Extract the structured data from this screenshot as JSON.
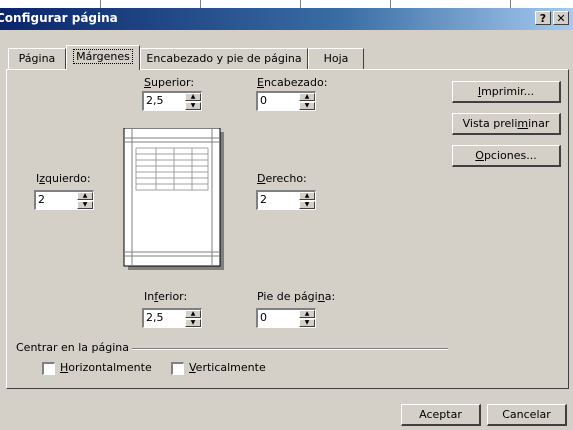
{
  "window": {
    "title": "Configurar página",
    "help_glyph": "?",
    "close_glyph": "✕"
  },
  "tabs": [
    {
      "label": "Página",
      "active": false
    },
    {
      "label": "Márgenes",
      "active": true
    },
    {
      "label": "Encabezado y pie de página",
      "active": false
    },
    {
      "label": "Hoja",
      "active": false
    }
  ],
  "margins": {
    "superior": {
      "label_pre": "",
      "label_u": "S",
      "label_post": "uperior:",
      "value": "2,5"
    },
    "encabezado": {
      "label_pre": "",
      "label_u": "E",
      "label_post": "ncabezado:",
      "value": "0"
    },
    "izquierdo": {
      "label_pre": "I",
      "label_u": "z",
      "label_post": "quierdo:",
      "value": "2"
    },
    "derecho": {
      "label_pre": "",
      "label_u": "D",
      "label_post": "erecho:",
      "value": "2"
    },
    "inferior": {
      "label_pre": "In",
      "label_u": "f",
      "label_post": "erior:",
      "value": "2,5"
    },
    "pie": {
      "label_pre": "Pie de pági",
      "label_u": "n",
      "label_post": "a:",
      "value": "0"
    }
  },
  "buttons": {
    "imprimir": {
      "pre": "",
      "u": "I",
      "post": "mprimir..."
    },
    "vista": {
      "pre": "Vista preli",
      "u": "m",
      "post": "inar"
    },
    "opciones": {
      "pre": "",
      "u": "O",
      "post": "pciones..."
    },
    "aceptar": "Aceptar",
    "cancelar": "Cancelar"
  },
  "center": {
    "group_label": "Centrar en la página",
    "horizontal": {
      "u": "H",
      "post": "orizontalmente",
      "checked": false
    },
    "vertical": {
      "u": "V",
      "post": "erticalmente",
      "checked": false
    }
  },
  "icons": {
    "spin_up": "up-triangle",
    "spin_down": "down-triangle"
  },
  "colors": {
    "titlebar_start": "#0a246a",
    "titlebar_end": "#a6caf0",
    "face": "#d4d0c8"
  }
}
